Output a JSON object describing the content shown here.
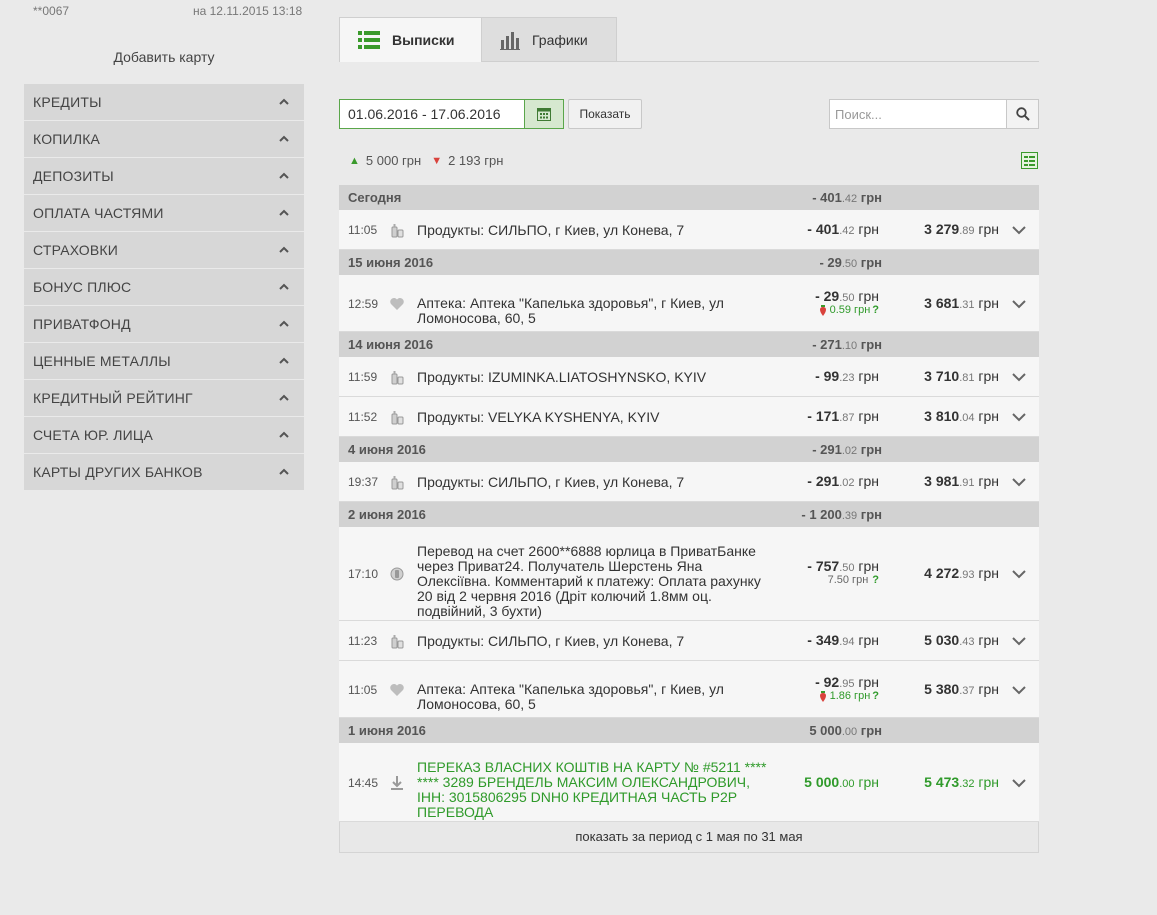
{
  "account": {
    "card_mask": "**0067",
    "date_label": "на 12.11.2015 13:18",
    "add_card": "Добавить карту"
  },
  "sidebar": {
    "items": [
      {
        "label": "КРЕДИТЫ"
      },
      {
        "label": "КОПИЛКА"
      },
      {
        "label": "ДЕПОЗИТЫ"
      },
      {
        "label": "ОПЛАТА ЧАСТЯМИ"
      },
      {
        "label": "СТРАХОВКИ"
      },
      {
        "label": "БОНУС ПЛЮС"
      },
      {
        "label": "ПРИВАТФОНД"
      },
      {
        "label": "ЦЕННЫЕ МЕТАЛЛЫ"
      },
      {
        "label": "КРЕДИТНЫЙ РЕЙТИНГ"
      },
      {
        "label": "СЧЕТА ЮР. ЛИЦА"
      },
      {
        "label": "КАРТЫ ДРУГИХ БАНКОВ"
      }
    ]
  },
  "tabs": {
    "statements": "Выписки",
    "charts": "Графики"
  },
  "filters": {
    "period": "01.06.2016 - 17.06.2016",
    "show": "Показать",
    "search_placeholder": "Поиск..."
  },
  "totals": {
    "income": "5 000 грн",
    "expense": "2 193 грн"
  },
  "colors": {
    "accent": "#3a9a2c",
    "down": "#d9423c",
    "group_bg": "#d2d2d2",
    "row_bg": "#f6f6f6"
  },
  "groups": [
    {
      "label": "Сегодня",
      "sum_main": "- 401",
      "sum_cents": ".42",
      "currency": "грн",
      "rows": [
        {
          "time": "11:05",
          "icon": "grocery-icon",
          "desc": "Продукты: СИЛЬПО, г Киев, ул Конева, 7",
          "amt_main": "- 401",
          "amt_cents": ".42",
          "currency": "грн",
          "bal_main": "3 279",
          "bal_cents": ".89"
        }
      ]
    },
    {
      "label": "15 июня 2016",
      "sum_main": "- 29",
      "sum_cents": ".50",
      "currency": "грн",
      "rows": [
        {
          "time": "12:59",
          "icon": "heart-icon",
          "desc": "Аптека: Аптека \"Капелька здоровья\", г Киев, ул Ломоносова, 60, 5",
          "amt_main": "- 29",
          "amt_cents": ".50",
          "currency": "грн",
          "bonus": "0.59 грн",
          "bal_main": "3 681",
          "bal_cents": ".31"
        }
      ]
    },
    {
      "label": "14 июня 2016",
      "sum_main": "- 271",
      "sum_cents": ".10",
      "currency": "грн",
      "rows": [
        {
          "time": "11:59",
          "icon": "grocery-icon",
          "desc": "Продукты: IZUMINKA.LIATOSHYNSKO, KYIV",
          "amt_main": "- 99",
          "amt_cents": ".23",
          "currency": "грн",
          "bal_main": "3 710",
          "bal_cents": ".81"
        },
        {
          "time": "11:52",
          "icon": "grocery-icon",
          "desc": "Продукты: VELYKA KYSHENYA, KYIV",
          "amt_main": "- 171",
          "amt_cents": ".87",
          "currency": "грн",
          "bal_main": "3 810",
          "bal_cents": ".04"
        }
      ]
    },
    {
      "label": "4 июня 2016",
      "sum_main": "- 291",
      "sum_cents": ".02",
      "currency": "грн",
      "rows": [
        {
          "time": "19:37",
          "icon": "grocery-icon",
          "desc": "Продукты: СИЛЬПО, г Киев, ул Конева, 7",
          "amt_main": "- 291",
          "amt_cents": ".02",
          "currency": "грн",
          "bal_main": "3 981",
          "bal_cents": ".91"
        }
      ]
    },
    {
      "label": "2 июня 2016",
      "sum_main": "- 1 200",
      "sum_cents": ".39",
      "currency": "грн",
      "rows": [
        {
          "time": "17:10",
          "icon": "transfer-icon",
          "desc": "Перевод на счет 2600**6888 юрлица в ПриватБанке через Приват24. Получатель Шерстень Яна Олексіївна. Комментарий к платежу: Оплата рахунку 20 від 2 червня 2016 (Дріт колючий 1.8мм оц. подвійний, 3 бухти)",
          "amt_main": "- 757",
          "amt_cents": ".50",
          "currency": "грн",
          "fee": "7.50 грн",
          "bal_main": "4 272",
          "bal_cents": ".93"
        },
        {
          "time": "11:23",
          "icon": "grocery-icon",
          "desc": "Продукты: СИЛЬПО, г Киев, ул Конева, 7",
          "amt_main": "- 349",
          "amt_cents": ".94",
          "currency": "грн",
          "bal_main": "5 030",
          "bal_cents": ".43"
        },
        {
          "time": "11:05",
          "icon": "heart-icon",
          "desc": "Аптека: Аптека \"Капелька здоровья\", г Киев, ул Ломоносова, 60, 5",
          "amt_main": "- 92",
          "amt_cents": ".95",
          "currency": "грн",
          "bonus": "1.86 грн",
          "bal_main": "5 380",
          "bal_cents": ".37"
        }
      ]
    },
    {
      "label": "1 июня 2016",
      "sum_main": "5 000",
      "sum_cents": ".00",
      "currency": "грн",
      "rows": [
        {
          "time": "14:45",
          "icon": "download-icon",
          "desc": "ПЕРЕКАЗ ВЛАСНИХ КОШТІВ НА КАРТУ № #5211 **** **** 3289 БРЕНДЕЛЬ МАКСИМ ОЛЕКСАНДРОВИЧ, ІНН: 3015806295 DNH0 КРЕДИТНАЯ ЧАСТЬ P2P ПЕРЕВОДА",
          "amt_main": "5 000",
          "amt_cents": ".00",
          "currency": "грн",
          "bal_main": "5 473",
          "bal_cents": ".32",
          "income": true
        }
      ]
    }
  ],
  "more": "показать за период с 1 мая по 31 мая"
}
